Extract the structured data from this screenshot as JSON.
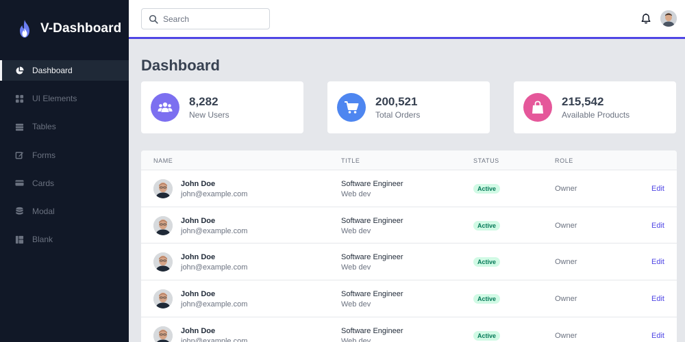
{
  "brand": {
    "name": "V-Dashboard"
  },
  "sidebar": {
    "items": [
      {
        "label": "Dashboard",
        "icon": "pie-chart-icon",
        "active": true
      },
      {
        "label": "UI Elements",
        "icon": "grid-icon"
      },
      {
        "label": "Tables",
        "icon": "table-icon"
      },
      {
        "label": "Forms",
        "icon": "edit-icon"
      },
      {
        "label": "Cards",
        "icon": "card-icon"
      },
      {
        "label": "Modal",
        "icon": "database-icon"
      },
      {
        "label": "Blank",
        "icon": "layout-icon"
      }
    ]
  },
  "header": {
    "search_placeholder": "Search",
    "notification_icon": "bell-icon",
    "accent_color": "#4f46e5"
  },
  "page": {
    "title": "Dashboard"
  },
  "stats": [
    {
      "value": "8,282",
      "label": "New Users",
      "icon": "users-icon",
      "color": "#7c6ff0"
    },
    {
      "value": "200,521",
      "label": "Total Orders",
      "icon": "shopping-cart-icon",
      "color": "#4e86f0"
    },
    {
      "value": "215,542",
      "label": "Available Products",
      "icon": "shopping-bag-icon",
      "color": "#e5579a"
    }
  ],
  "table": {
    "headers": [
      "NAME",
      "TITLE",
      "STATUS",
      "ROLE"
    ],
    "rows": [
      {
        "name": "John Doe",
        "email": "john@example.com",
        "title": "Software Engineer",
        "department": "Web dev",
        "status": "Active",
        "role": "Owner",
        "action": "Edit"
      },
      {
        "name": "John Doe",
        "email": "john@example.com",
        "title": "Software Engineer",
        "department": "Web dev",
        "status": "Active",
        "role": "Owner",
        "action": "Edit"
      },
      {
        "name": "John Doe",
        "email": "john@example.com",
        "title": "Software Engineer",
        "department": "Web dev",
        "status": "Active",
        "role": "Owner",
        "action": "Edit"
      },
      {
        "name": "John Doe",
        "email": "john@example.com",
        "title": "Software Engineer",
        "department": "Web dev",
        "status": "Active",
        "role": "Owner",
        "action": "Edit"
      },
      {
        "name": "John Doe",
        "email": "john@example.com",
        "title": "Software Engineer",
        "department": "Web dev",
        "status": "Active",
        "role": "Owner",
        "action": "Edit"
      }
    ]
  }
}
